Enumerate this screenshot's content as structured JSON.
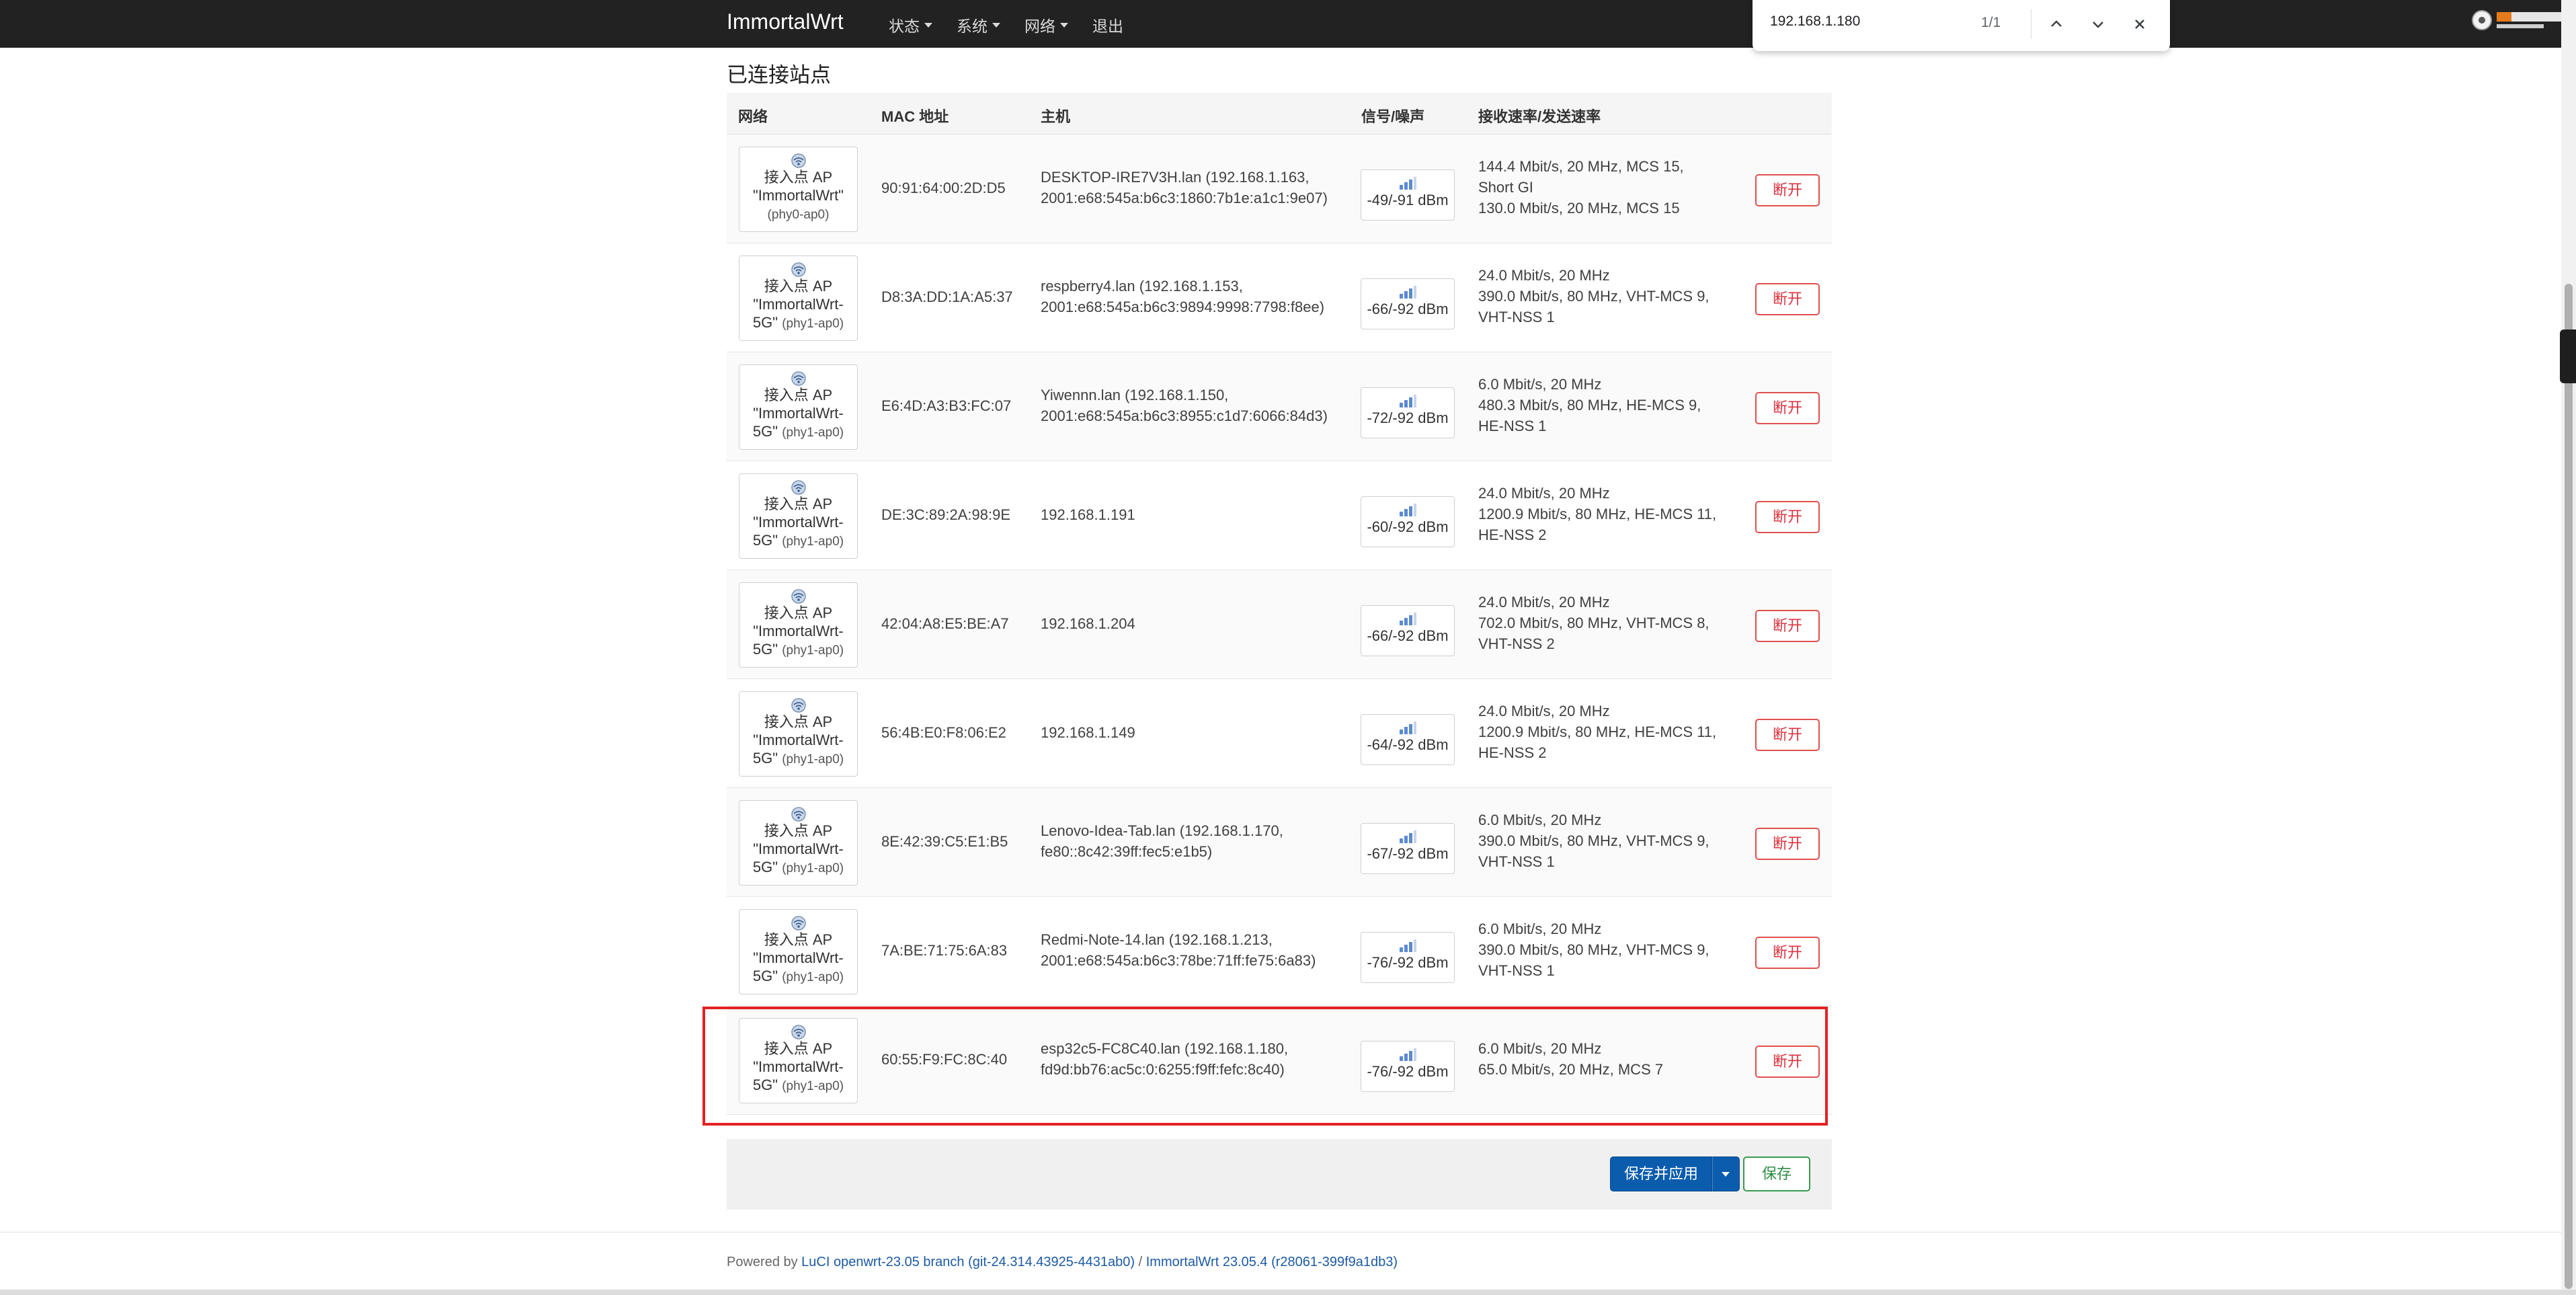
{
  "navbar": {
    "brand": "ImmortalWrt",
    "menu": [
      {
        "label": "状态",
        "has_caret": true
      },
      {
        "label": "系统",
        "has_caret": true
      },
      {
        "label": "网络",
        "has_caret": true
      },
      {
        "label": "退出",
        "has_caret": false
      }
    ]
  },
  "find_bar": {
    "query": "192.168.1.180",
    "count": "1/1",
    "icons": [
      "chevron-up-icon",
      "chevron-down-icon",
      "close-icon"
    ]
  },
  "section_title": "已连接站点",
  "table": {
    "headers": [
      "网络",
      "MAC 地址",
      "主机",
      "信号/噪声",
      "接收速率/发送速率"
    ],
    "rows": [
      {
        "net_line1": "接入点 AP",
        "net_line2": "\"ImmortalWrt\"",
        "net_line3": "",
        "net_dev": "(phy0-ap0)",
        "mac": "90:91:64:00:2D:D5",
        "host_line1": "DESKTOP-IRE7V3H.lan (192.168.1.163,",
        "host_line2": "2001:e68:545a:b6c3:1860:7b1e:a1c1:9e07)",
        "signal": "-49/-91 dBm",
        "rate_line1": "144.4 Mbit/s, 20 MHz, MCS 15,",
        "rate_line2": "Short GI",
        "rate_line3": "130.0 Mbit/s, 20 MHz, MCS 15",
        "action": "断开"
      },
      {
        "net_line1": "接入点 AP",
        "net_line2": "\"ImmortalWrt-",
        "net_line3": "5G\"",
        "net_dev": "(phy1-ap0)",
        "mac": "D8:3A:DD:1A:A5:37",
        "host_line1": "respberry4.lan (192.168.1.153,",
        "host_line2": "2001:e68:545a:b6c3:9894:9998:7798:f8ee)",
        "signal": "-66/-92 dBm",
        "rate_line1": "24.0 Mbit/s, 20 MHz",
        "rate_line2": "390.0 Mbit/s, 80 MHz, VHT-MCS 9,",
        "rate_line3": "VHT-NSS 1",
        "action": "断开"
      },
      {
        "net_line1": "接入点 AP",
        "net_line2": "\"ImmortalWrt-",
        "net_line3": "5G\"",
        "net_dev": "(phy1-ap0)",
        "mac": "E6:4D:A3:B3:FC:07",
        "host_line1": "Yiwennn.lan (192.168.1.150,",
        "host_line2": "2001:e68:545a:b6c3:8955:c1d7:6066:84d3)",
        "signal": "-72/-92 dBm",
        "rate_line1": "6.0 Mbit/s, 20 MHz",
        "rate_line2": "480.3 Mbit/s, 80 MHz, HE-MCS 9,",
        "rate_line3": "HE-NSS 1",
        "action": "断开"
      },
      {
        "net_line1": "接入点 AP",
        "net_line2": "\"ImmortalWrt-",
        "net_line3": "5G\"",
        "net_dev": "(phy1-ap0)",
        "mac": "DE:3C:89:2A:98:9E",
        "host_line1": "192.168.1.191",
        "host_line2": "",
        "signal": "-60/-92 dBm",
        "rate_line1": "24.0 Mbit/s, 20 MHz",
        "rate_line2": "1200.9 Mbit/s, 80 MHz, HE-MCS 11,",
        "rate_line3": "HE-NSS 2",
        "action": "断开"
      },
      {
        "net_line1": "接入点 AP",
        "net_line2": "\"ImmortalWrt-",
        "net_line3": "5G\"",
        "net_dev": "(phy1-ap0)",
        "mac": "42:04:A8:E5:BE:A7",
        "host_line1": "192.168.1.204",
        "host_line2": "",
        "signal": "-66/-92 dBm",
        "rate_line1": "24.0 Mbit/s, 20 MHz",
        "rate_line2": "702.0 Mbit/s, 80 MHz, VHT-MCS 8,",
        "rate_line3": "VHT-NSS 2",
        "action": "断开"
      },
      {
        "net_line1": "接入点 AP",
        "net_line2": "\"ImmortalWrt-",
        "net_line3": "5G\"",
        "net_dev": "(phy1-ap0)",
        "mac": "56:4B:E0:F8:06:E2",
        "host_line1": "192.168.1.149",
        "host_line2": "",
        "signal": "-64/-92 dBm",
        "rate_line1": "24.0 Mbit/s, 20 MHz",
        "rate_line2": "1200.9 Mbit/s, 80 MHz, HE-MCS 11,",
        "rate_line3": "HE-NSS 2",
        "action": "断开"
      },
      {
        "net_line1": "接入点 AP",
        "net_line2": "\"ImmortalWrt-",
        "net_line3": "5G\"",
        "net_dev": "(phy1-ap0)",
        "mac": "8E:42:39:C5:E1:B5",
        "host_line1": "Lenovo-Idea-Tab.lan (192.168.1.170,",
        "host_line2": "fe80::8c42:39ff:fec5:e1b5)",
        "signal": "-67/-92 dBm",
        "rate_line1": "6.0 Mbit/s, 20 MHz",
        "rate_line2": "390.0 Mbit/s, 80 MHz, VHT-MCS 9,",
        "rate_line3": "VHT-NSS 1",
        "action": "断开"
      },
      {
        "net_line1": "接入点 AP",
        "net_line2": "\"ImmortalWrt-",
        "net_line3": "5G\"",
        "net_dev": "(phy1-ap0)",
        "mac": "7A:BE:71:75:6A:83",
        "host_line1": "Redmi-Note-14.lan (192.168.1.213,",
        "host_line2": "2001:e68:545a:b6c3:78be:71ff:fe75:6a83)",
        "signal": "-76/-92 dBm",
        "rate_line1": "6.0 Mbit/s, 20 MHz",
        "rate_line2": "390.0 Mbit/s, 80 MHz, VHT-MCS 9,",
        "rate_line3": "VHT-NSS 1",
        "action": "断开"
      },
      {
        "net_line1": "接入点 AP",
        "net_line2": "\"ImmortalWrt-",
        "net_line3": "5G\"",
        "net_dev": "(phy1-ap0)",
        "mac": "60:55:F9:FC:8C:40",
        "host_line1": "esp32c5-FC8C40.lan (192.168.1.180,",
        "host_line2": "fd9d:bb76:ac5c:0:6255:f9ff:fefc:8c40)",
        "signal": "-76/-92 dBm",
        "rate_line1": "6.0 Mbit/s, 20 MHz",
        "rate_line2": "65.0 Mbit/s, 20 MHz, MCS 7",
        "rate_line3": "",
        "action": "断开"
      }
    ]
  },
  "actions": {
    "save_apply": "保存并应用",
    "save": "保存"
  },
  "footer": {
    "prefix": "Powered by ",
    "luci_link": "LuCI openwrt-23.05 branch (git-24.314.43925-4431ab0)",
    "separator": " / ",
    "version_link": "ImmortalWrt 23.05.4 (r28061-399f9a1db3)"
  },
  "colors": {
    "navbar": "#222222",
    "highlight_border": "#e32222",
    "disconnect": "#d9333f",
    "apply": "#0b5cad",
    "save": "#2e8b45",
    "link": "#1c5aa6"
  }
}
